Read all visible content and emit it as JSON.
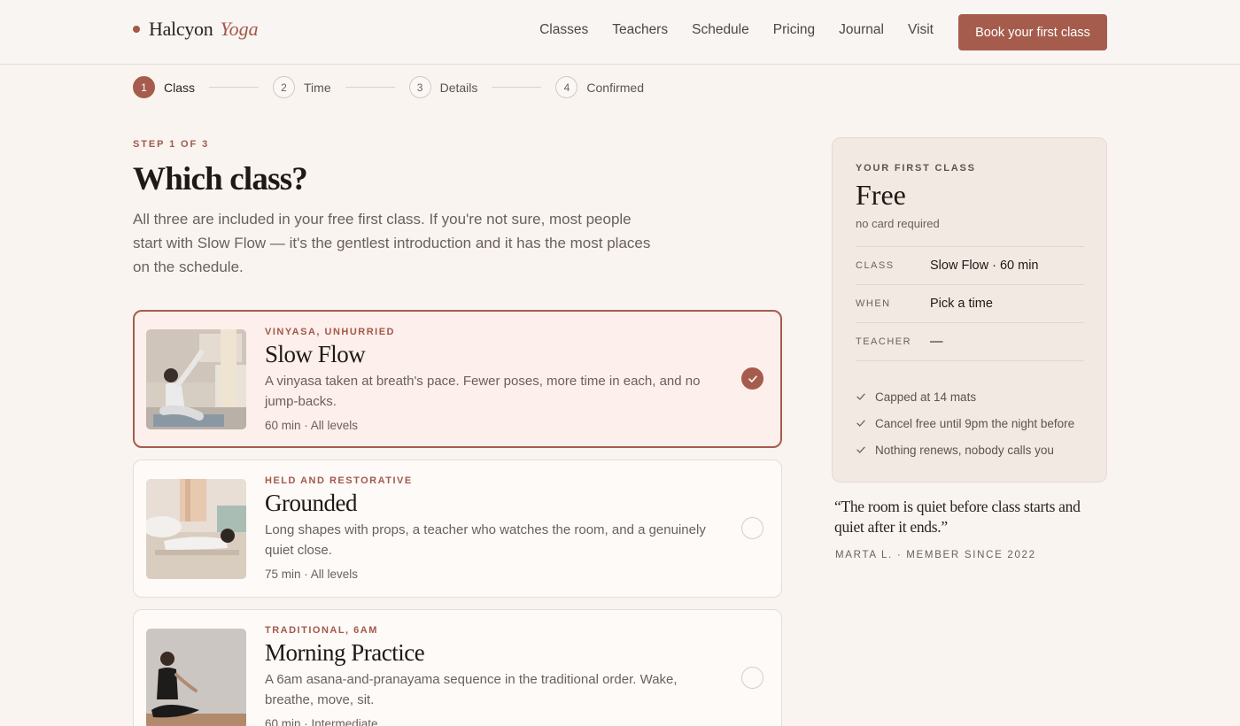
{
  "brand": {
    "name": "Halcyon",
    "accent": "Yoga",
    "color": "#a65c4d"
  },
  "nav": {
    "items": [
      "Classes",
      "Teachers",
      "Schedule",
      "Pricing",
      "Journal",
      "Visit"
    ],
    "cta": "Book your first class"
  },
  "stepper": {
    "steps": [
      {
        "num": "1",
        "label": "Class"
      },
      {
        "num": "2",
        "label": "Time"
      },
      {
        "num": "3",
        "label": "Details"
      },
      {
        "num": "4",
        "label": "Confirmed"
      }
    ]
  },
  "main": {
    "eyebrow": "STEP 1 OF 3",
    "title": "Which class?",
    "intro": "All three are included in your free first class. If you're not sure, most people start with Slow Flow — it's the gentlest introduction and it has the most places on the schedule."
  },
  "classes": [
    {
      "tag": "VINYASA, UNHURRIED",
      "name": "Slow Flow",
      "desc": "A vinyasa taken at breath's pace. Fewer poses, more time in each, and no jump-backs.",
      "meta": "60 min · All levels",
      "selected": true
    },
    {
      "tag": "HELD AND RESTORATIVE",
      "name": "Grounded",
      "desc": "Long shapes with props, a teacher who watches the room, and a genuinely quiet close.",
      "meta": "75 min · All levels",
      "selected": false
    },
    {
      "tag": "TRADITIONAL, 6AM",
      "name": "Morning Practice",
      "desc": "A 6am asana-and-pranayama sequence in the traditional order. Wake, breathe, move, sit.",
      "meta": "60 min · Intermediate",
      "selected": false
    }
  ],
  "summary": {
    "eyebrow": "YOUR FIRST CLASS",
    "price": "Free",
    "note": "no card required",
    "rows": [
      {
        "key": "CLASS",
        "value": "Slow Flow · 60 min"
      },
      {
        "key": "WHEN",
        "value": "Pick a time"
      },
      {
        "key": "TEACHER",
        "value": "—"
      }
    ],
    "perks": [
      "Capped at 14 mats",
      "Cancel free until 9pm the night before",
      "Nothing renews, nobody calls you"
    ]
  },
  "testimonial": {
    "quote": "“The room is quiet before class starts and quiet after it ends.”",
    "cite": "MARTA L. · MEMBER SINCE 2022"
  }
}
